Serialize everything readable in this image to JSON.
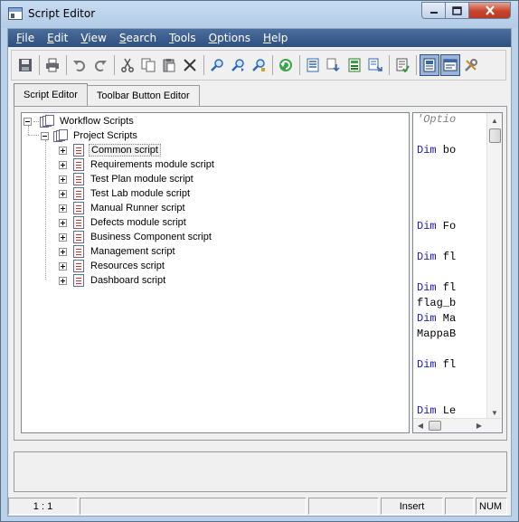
{
  "window": {
    "title": "Script Editor"
  },
  "menu": [
    {
      "first": "F",
      "rest": "ile"
    },
    {
      "first": "E",
      "rest": "dit"
    },
    {
      "first": "V",
      "rest": "iew"
    },
    {
      "first": "S",
      "rest": "earch"
    },
    {
      "first": "T",
      "rest": "ools"
    },
    {
      "first": "O",
      "rest": "ptions"
    },
    {
      "first": "H",
      "rest": "elp"
    }
  ],
  "tabs": {
    "script_editor": "Script Editor",
    "toolbar_button_editor": "Toolbar Button Editor"
  },
  "tree": {
    "root": "Workflow Scripts",
    "project": "Project Scripts",
    "scripts": [
      "Common script",
      "Requirements module script",
      "Test Plan module script",
      "Test Lab module script",
      "Manual Runner script",
      "Defects module script",
      "Business Component script",
      "Management script",
      "Resources script",
      "Dashboard script"
    ]
  },
  "code": {
    "lines": [
      {
        "kw": "",
        "text": "'Optio",
        "comment": true
      },
      {
        "kw": "Dim",
        "text": " bo"
      },
      {
        "kw": "Dim",
        "text": " Fo"
      },
      {
        "kw": "Dim",
        "text": " fl"
      },
      {
        "kw": "Dim",
        "text": " fl"
      },
      {
        "kw": "",
        "text": "flag_b"
      },
      {
        "kw": "Dim",
        "text": " Ma"
      },
      {
        "kw": "",
        "text": "MappaB"
      },
      {
        "kw": "Dim",
        "text": " fl"
      },
      {
        "kw": "Dim",
        "text": " Le"
      }
    ]
  },
  "status": {
    "position": "1 : 1",
    "mode": "Insert",
    "num": "NUM"
  },
  "colors": {
    "menubar": "#3b5e8e",
    "keyword": "#1a1ac8",
    "close_button": "#c7432b"
  }
}
